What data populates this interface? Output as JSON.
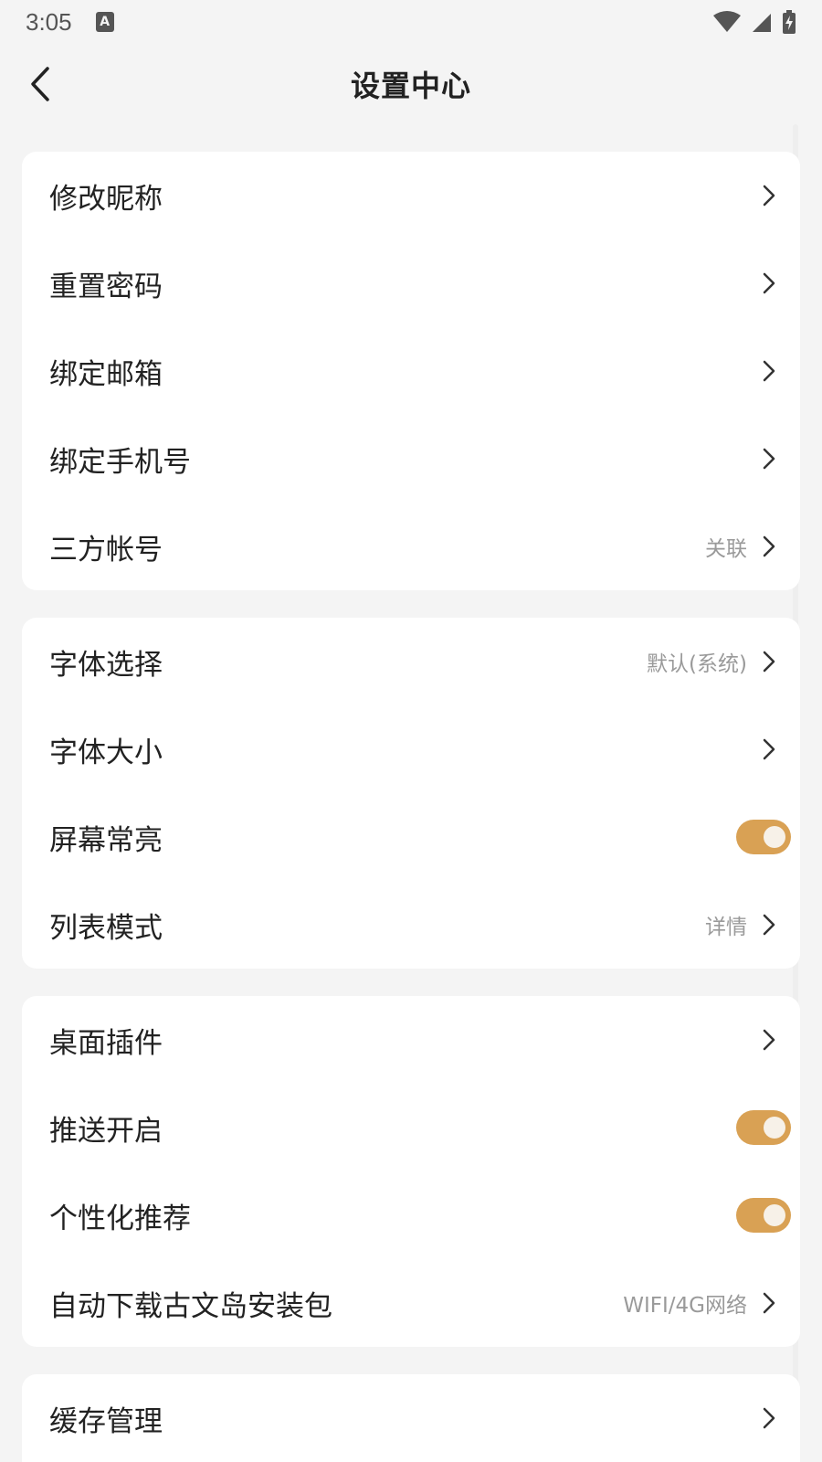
{
  "status_bar": {
    "time": "3:05",
    "notification_icon": "A"
  },
  "header": {
    "title": "设置中心"
  },
  "groups": [
    {
      "items": [
        {
          "label": "修改昵称",
          "value": "",
          "control": "chevron"
        },
        {
          "label": "重置密码",
          "value": "",
          "control": "chevron"
        },
        {
          "label": "绑定邮箱",
          "value": "",
          "control": "chevron"
        },
        {
          "label": "绑定手机号",
          "value": "",
          "control": "chevron"
        },
        {
          "label": "三方帐号",
          "value": "关联",
          "control": "chevron"
        }
      ]
    },
    {
      "items": [
        {
          "label": "字体选择",
          "value": "默认(系统)",
          "control": "chevron"
        },
        {
          "label": "字体大小",
          "value": "",
          "control": "chevron"
        },
        {
          "label": "屏幕常亮",
          "value": "",
          "control": "toggle",
          "on": true
        },
        {
          "label": "列表模式",
          "value": "详情",
          "control": "chevron"
        }
      ]
    },
    {
      "items": [
        {
          "label": "桌面插件",
          "value": "",
          "control": "chevron"
        },
        {
          "label": "推送开启",
          "value": "",
          "control": "toggle",
          "on": true
        },
        {
          "label": "个性化推荐",
          "value": "",
          "control": "toggle",
          "on": true
        },
        {
          "label": "自动下载古文岛安装包",
          "value": "WIFI/4G网络",
          "control": "chevron"
        }
      ]
    },
    {
      "items": [
        {
          "label": "缓存管理",
          "value": "",
          "control": "chevron"
        }
      ]
    }
  ],
  "colors": {
    "accent": "#d9a154",
    "background": "#f4f4f4",
    "card": "#ffffff"
  }
}
